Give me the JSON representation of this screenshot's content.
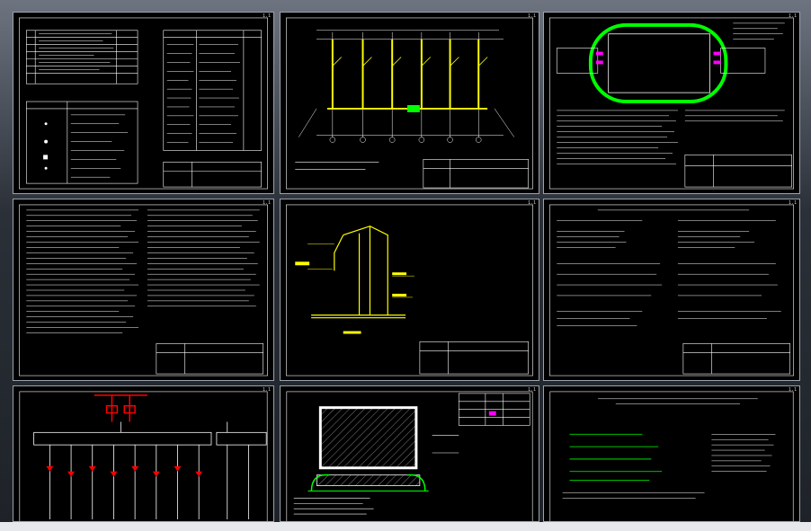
{
  "viewer": {
    "sheets": [
      {
        "id": "sheet-1",
        "number": "1.1",
        "kind": "table"
      },
      {
        "id": "sheet-2",
        "number": "1.1",
        "kind": "plan"
      },
      {
        "id": "sheet-3",
        "number": "1.1",
        "kind": "ring"
      },
      {
        "id": "sheet-4",
        "number": "1.1",
        "kind": "text"
      },
      {
        "id": "sheet-5",
        "number": "1.1",
        "kind": "detail"
      },
      {
        "id": "sheet-6",
        "number": "1.1",
        "kind": "formulas"
      },
      {
        "id": "sheet-7",
        "number": "1.1",
        "kind": "schematic"
      },
      {
        "id": "sheet-8",
        "number": "1.1",
        "kind": "ground"
      },
      {
        "id": "sheet-9",
        "number": "1.1",
        "kind": "calc"
      }
    ],
    "colors": {
      "background": "#000000",
      "line": "#ffffff",
      "yellow": "#ffff00",
      "green": "#00ff00",
      "red": "#ff0000",
      "magenta": "#ff00ff",
      "cyan": "#00ffff"
    }
  }
}
